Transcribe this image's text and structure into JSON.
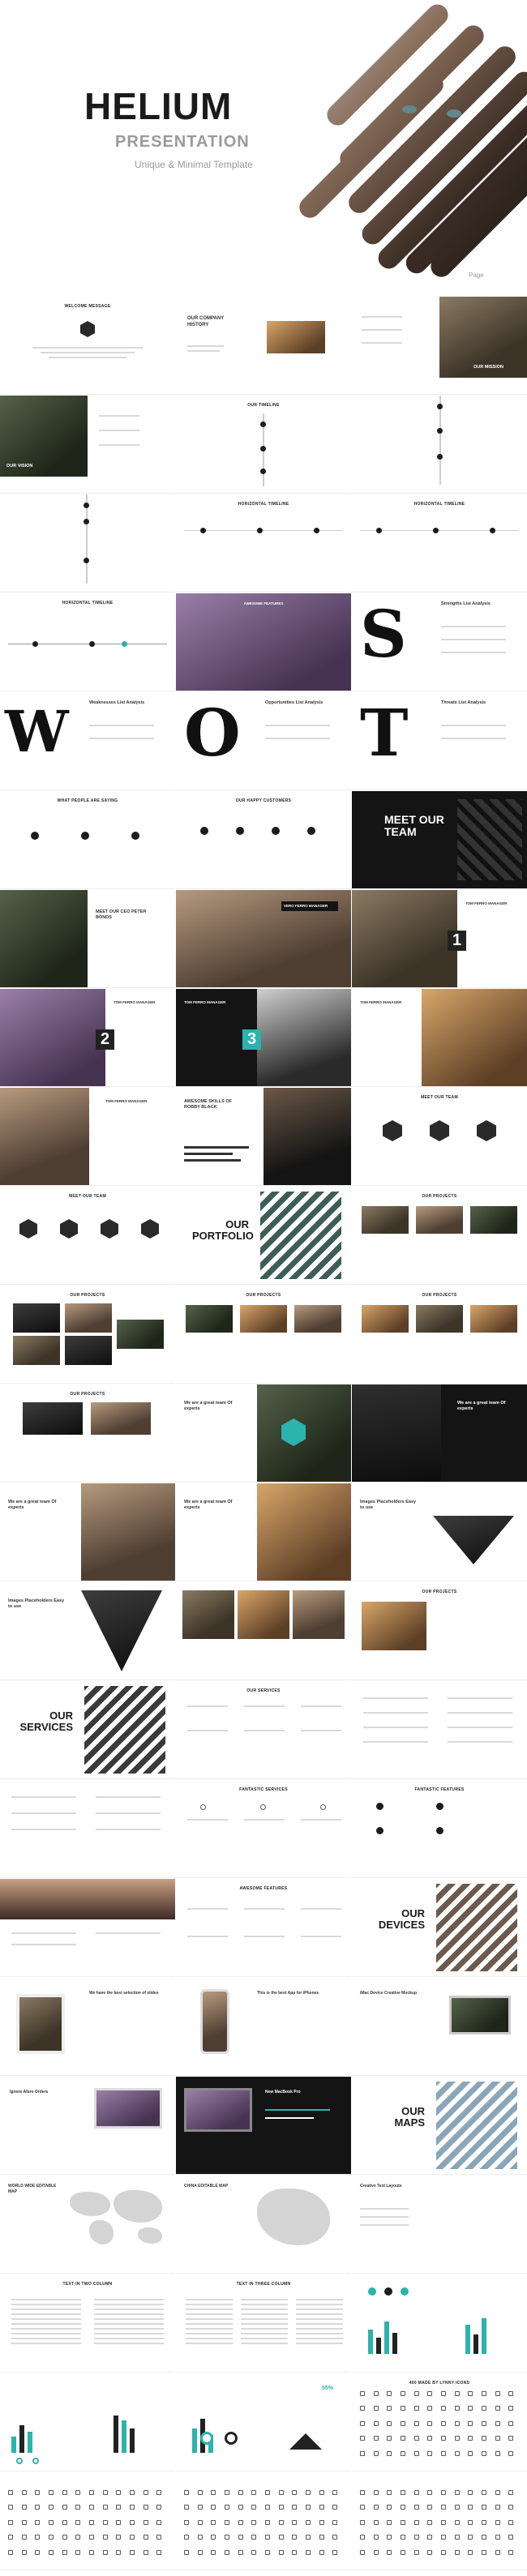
{
  "cover": {
    "title": "HELIUM",
    "subtitle": "PRESENTATION",
    "tagline": "Unique & Minimal Template",
    "page": "Page"
  },
  "slides": {
    "r1": [
      "WELCOME MESSAGE",
      "OUR COMPANY HISTORY",
      ""
    ],
    "r1_mission": "OUR MISSION",
    "r2": [
      "OUR VISION",
      "OUR TIMELINE",
      ""
    ],
    "r3": [
      "",
      "HORIZONTAL TIMELINE",
      "HORIZONTAL TIMELINE"
    ],
    "r4": [
      "HORIZONTAL TIMELINE",
      "AWESOME FEATURES",
      "Strengths List Analysis"
    ],
    "r5": [
      "Weaknesses List Analysis",
      "Opportunities List Analysis",
      "Threats List Analysis"
    ],
    "r6": [
      "WHAT PEOPLE ARE SAYING",
      "OUR HAPPY CUSTOMERS",
      "MEET OUR TEAM"
    ],
    "r7": [
      "MEET OUR CEO PETER BONDS",
      "VERO FERRO MANAGER",
      "TOM FERRO MANAGER"
    ],
    "r7_num": "1",
    "r8": [
      "TOM FERRO MANAGER",
      "TOM FERRO MANAGER",
      "TOM FERRO MANAGER"
    ],
    "r8_num": [
      "2",
      "3"
    ],
    "r9": [
      "TOM FERRO MANAGER",
      "AWESOME SKILLS OF ROBBY BLACK",
      "MEET OUR TEAM"
    ],
    "r10": [
      "MEET OUR TEAM",
      "OUR PORTFOLIO",
      "OUR PROJECTS"
    ],
    "r11": [
      "OUR PROJECTS",
      "OUR PROJECTS",
      "OUR PROJECTS"
    ],
    "r12": [
      "OUR PROJECTS",
      "We are a great team Of experts",
      "We are a great team Of experts"
    ],
    "r13": [
      "We are a great team Of experts",
      "We are a great team Of experts",
      "Images Placeholders Easy to use"
    ],
    "r14": [
      "Images Placeholders Easy to use",
      "",
      "OUR PROJECTS"
    ],
    "r15": [
      "OUR SERVICES",
      "OUR SERVICES",
      ""
    ],
    "r16": [
      "",
      "FANTASTIC SERVICES",
      "FANTASTIC FEATURES"
    ],
    "r17": [
      "",
      "AWESOME FEATURES",
      "OUR DEVICES"
    ],
    "r18": [
      "We have the best selection of slides",
      "This is the best App for iPhones",
      "iMac Device Creative Mockup"
    ],
    "r19": [
      "Ignore Afore Orders",
      "New MacBook Pro",
      "OUR MAPS"
    ],
    "r20": [
      "WORLD WIDE EDITABLE MAP",
      "CHINA EDITABLE MAP",
      "Creative Text Layouts"
    ],
    "r21": [
      "TEXT IN TWO COLUMN",
      "TEXT IN THREE COLUMN",
      ""
    ],
    "r22": [
      "",
      "",
      "400 MADE BY LYNNY ICONS"
    ],
    "r22_pct": "55%",
    "r23": [
      "",
      "",
      ""
    ]
  },
  "colors": {
    "accent": "#2bb3ad",
    "dark": "#141414"
  }
}
